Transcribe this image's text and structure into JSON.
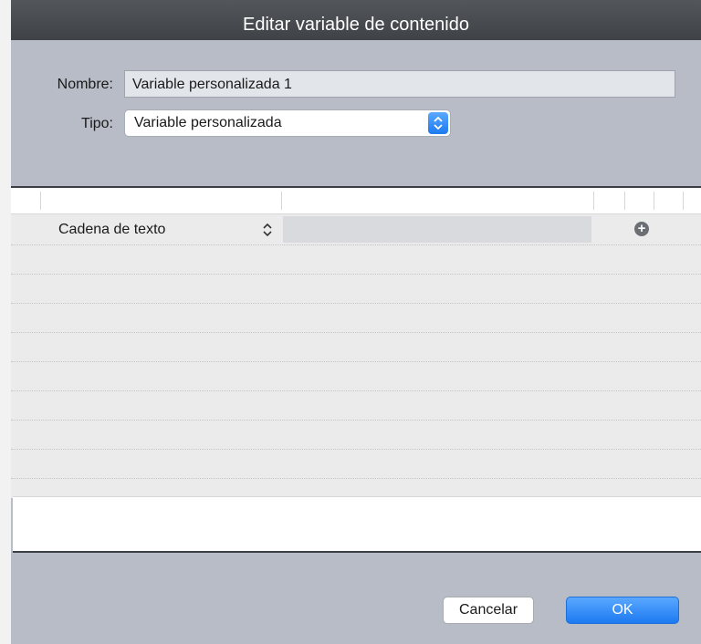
{
  "window": {
    "title": "Editar variable de contenido"
  },
  "form": {
    "name_label": "Nombre:",
    "name_value": "Variable personalizada 1",
    "type_label": "Tipo:",
    "type_value": "Variable personalizada",
    "type_stepper_icon": "chevron-up-down-icon"
  },
  "table": {
    "rows": [
      {
        "label": "Cadena de texto",
        "stepper_icon": "chevron-up-down-icon",
        "value": "",
        "action_icon": "add-circle-icon"
      }
    ]
  },
  "footer": {
    "text_value": ""
  },
  "buttons": {
    "cancel": "Cancelar",
    "ok": "OK"
  },
  "colors": {
    "accent": "#1d7af1",
    "title_bar": "#474a4e",
    "dialog_bg": "#b7bcc6"
  }
}
